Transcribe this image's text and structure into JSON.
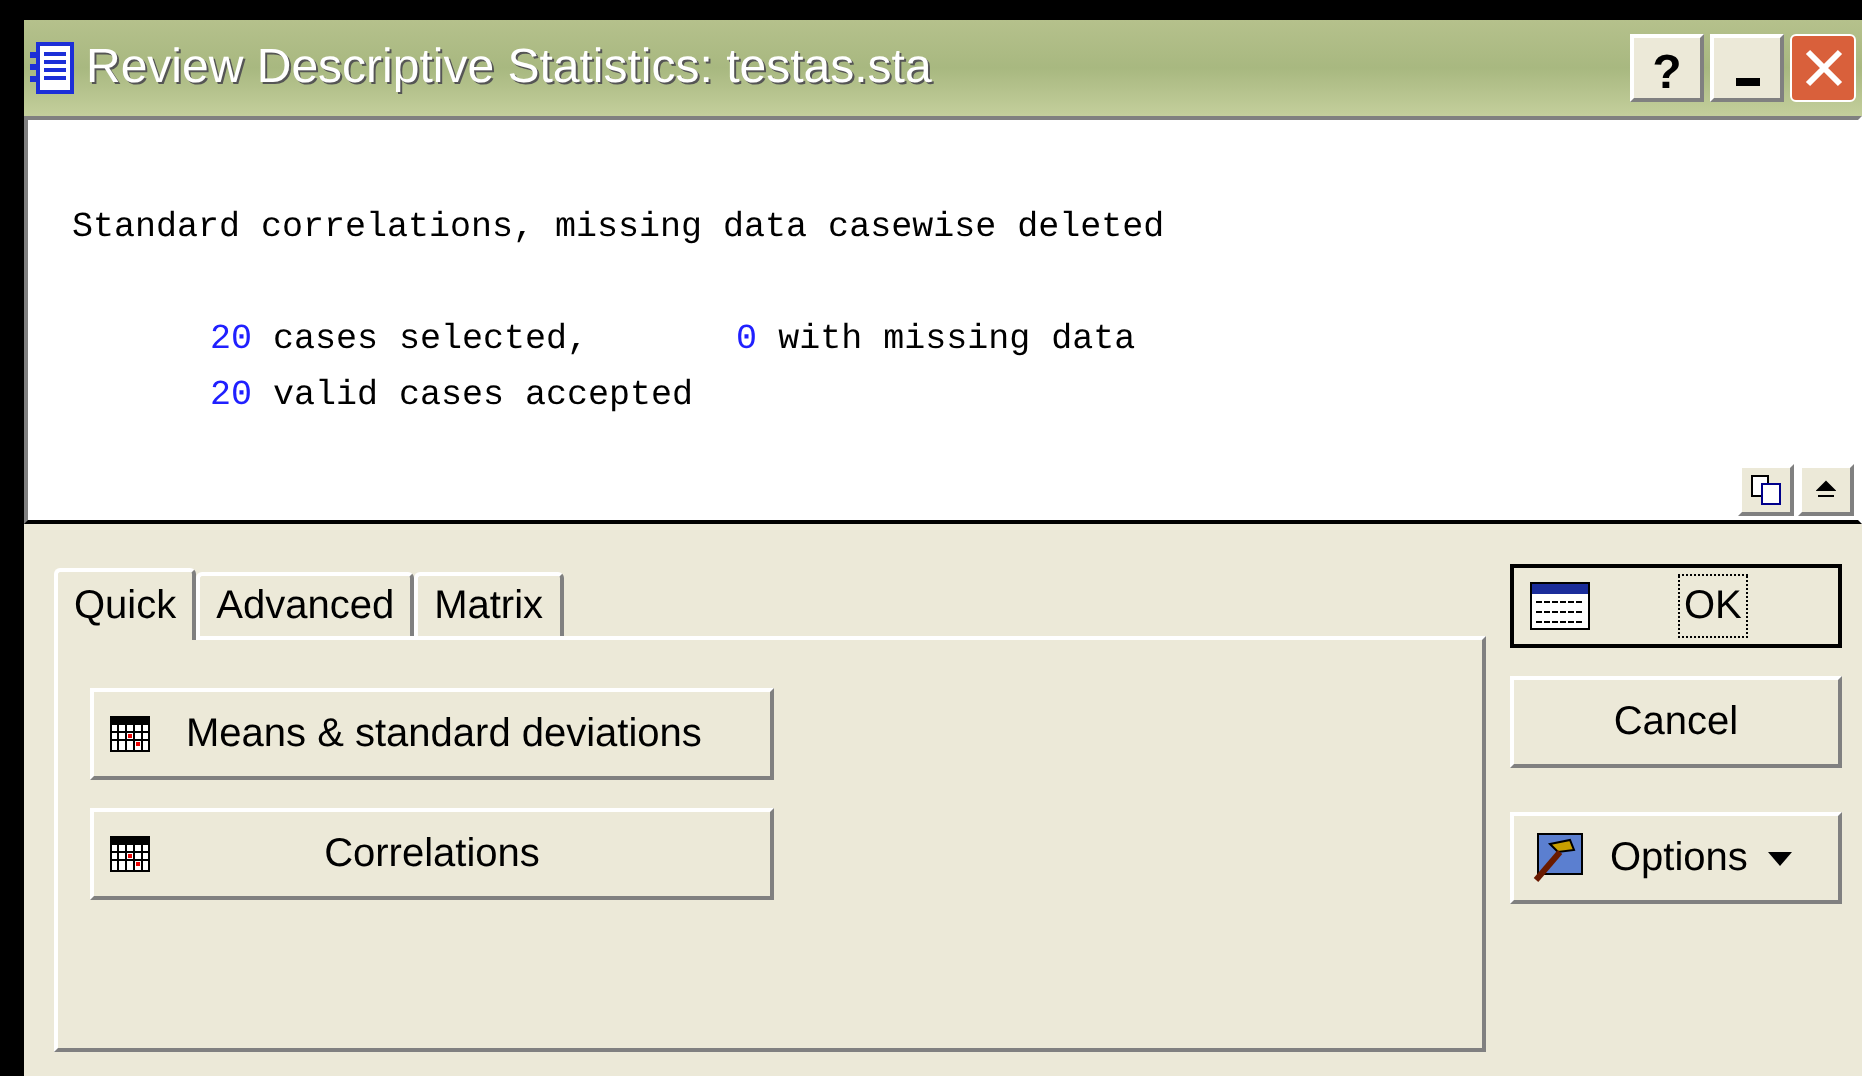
{
  "window": {
    "title": "Review Descriptive Statistics: testas.sta",
    "controls": [
      "?"
    ]
  },
  "output": {
    "lines": [
      {
        "parts": [
          {
            "kind": "text",
            "text": "Standard correlations, missing data casewise deleted"
          }
        ]
      },
      {
        "parts": [
          {
            "kind": "number",
            "text": "20"
          },
          {
            "kind": "text",
            "text": " cases selected,"
          },
          {
            "kind": "number",
            "text": "0"
          },
          {
            "kind": "text",
            "text": " with missing data"
          }
        ]
      },
      {
        "parts": [
          {
            "kind": "number",
            "text": "20"
          },
          {
            "kind": "text",
            "text": " valid cases accepted"
          }
        ]
      }
    ]
  },
  "tabs": [
    {
      "label": "Quick",
      "selected": true
    },
    {
      "label": "Advanced",
      "selected": false
    },
    {
      "label": "Matrix",
      "selected": false
    }
  ],
  "quick_buttons": [
    {
      "label": "Means & standard deviations"
    },
    {
      "label": "Correlations"
    }
  ],
  "side_buttons": [
    {
      "kind": "ok",
      "label": "OK"
    },
    {
      "kind": "plain",
      "label": "Cancel"
    },
    {
      "kind": "options",
      "label": "Options"
    }
  ]
}
